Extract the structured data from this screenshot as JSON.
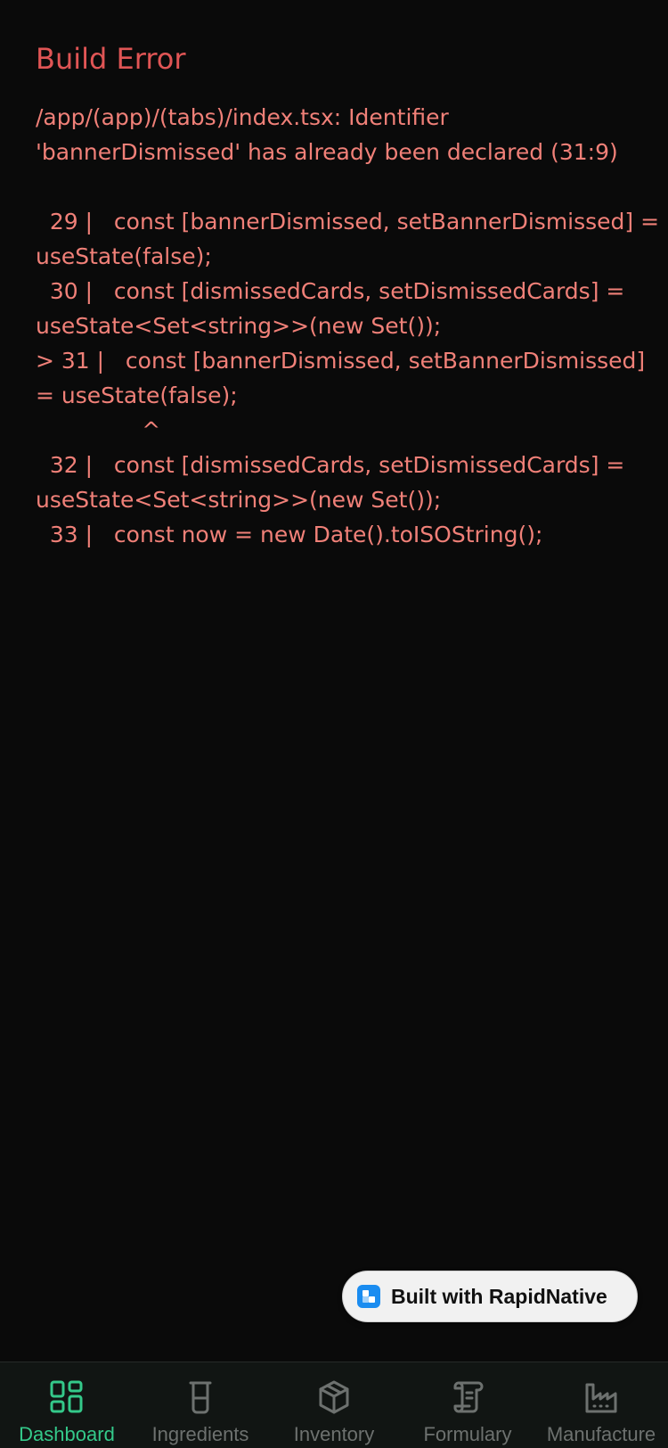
{
  "error": {
    "title": "Build Error",
    "message": "/app/(app)/(tabs)/index.tsx: Identifier\n'bannerDismissed' has already been declared (31:9)\n\n  29 |   const [bannerDismissed, setBannerDismissed] =\nuseState(false);\n  30 |   const [dismissedCards, setDismissedCards] =\nuseState<Set<string>>(new Set());\n> 31 |   const [bannerDismissed, setBannerDismissed]\n= useState(false);\n               ^\n  32 |   const [dismissedCards, setDismissedCards] =\nuseState<Set<string>>(new Set());\n  33 |   const now = new Date().toISOString();"
  },
  "badge": {
    "label": "Built with RapidNative",
    "logo_icon": "rapidnative-logo-icon"
  },
  "tabs": [
    {
      "label": "Dashboard",
      "icon": "dashboard-grid-icon",
      "active": true
    },
    {
      "label": "Ingredients",
      "icon": "beaker-icon",
      "active": false
    },
    {
      "label": "Inventory",
      "icon": "package-box-icon",
      "active": false
    },
    {
      "label": "Formulary",
      "icon": "scroll-icon",
      "active": false
    },
    {
      "label": "Manufacture",
      "icon": "factory-icon",
      "active": false
    }
  ],
  "colors": {
    "background": "#0a0a0a",
    "error_title": "#e05555",
    "error_text": "#f08078",
    "tab_active": "#34c98a",
    "tab_inactive": "#6d716f",
    "tab_bar": "#111513",
    "badge_bg": "#f1f1f1",
    "badge_logo": "#1a8cf0"
  }
}
